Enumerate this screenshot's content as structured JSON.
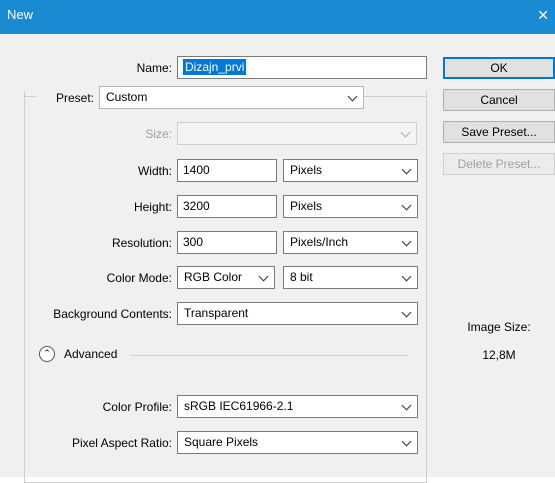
{
  "window": {
    "title": "New",
    "close_glyph": "✕"
  },
  "name": {
    "label": "Name:",
    "value": "Dizajn_prvi"
  },
  "preset": {
    "label": "Preset:",
    "value": "Custom"
  },
  "size": {
    "label": "Size:",
    "value": ""
  },
  "width": {
    "label": "Width:",
    "value": "1400",
    "unit": "Pixels"
  },
  "height": {
    "label": "Height:",
    "value": "3200",
    "unit": "Pixels"
  },
  "resolution": {
    "label": "Resolution:",
    "value": "300",
    "unit": "Pixels/Inch"
  },
  "color_mode": {
    "label": "Color Mode:",
    "value": "RGB Color",
    "depth": "8 bit"
  },
  "background": {
    "label": "Background Contents:",
    "value": "Transparent"
  },
  "advanced": {
    "label": "Advanced",
    "icon": "chevron-up-double-icon",
    "glyph": "⌃"
  },
  "color_profile": {
    "label": "Color Profile:",
    "value": "sRGB IEC61966-2.1"
  },
  "pixel_aspect": {
    "label": "Pixel Aspect Ratio:",
    "value": "Square Pixels"
  },
  "buttons": {
    "ok": "OK",
    "cancel": "Cancel",
    "save_preset": "Save Preset...",
    "delete_preset": "Delete Preset..."
  },
  "image_size": {
    "label": "Image Size:",
    "value": "12,8M"
  },
  "colors": {
    "titlebar": "#1a8ad2",
    "selection": "#0078d7",
    "dialog_bg": "#f0f0f0"
  }
}
